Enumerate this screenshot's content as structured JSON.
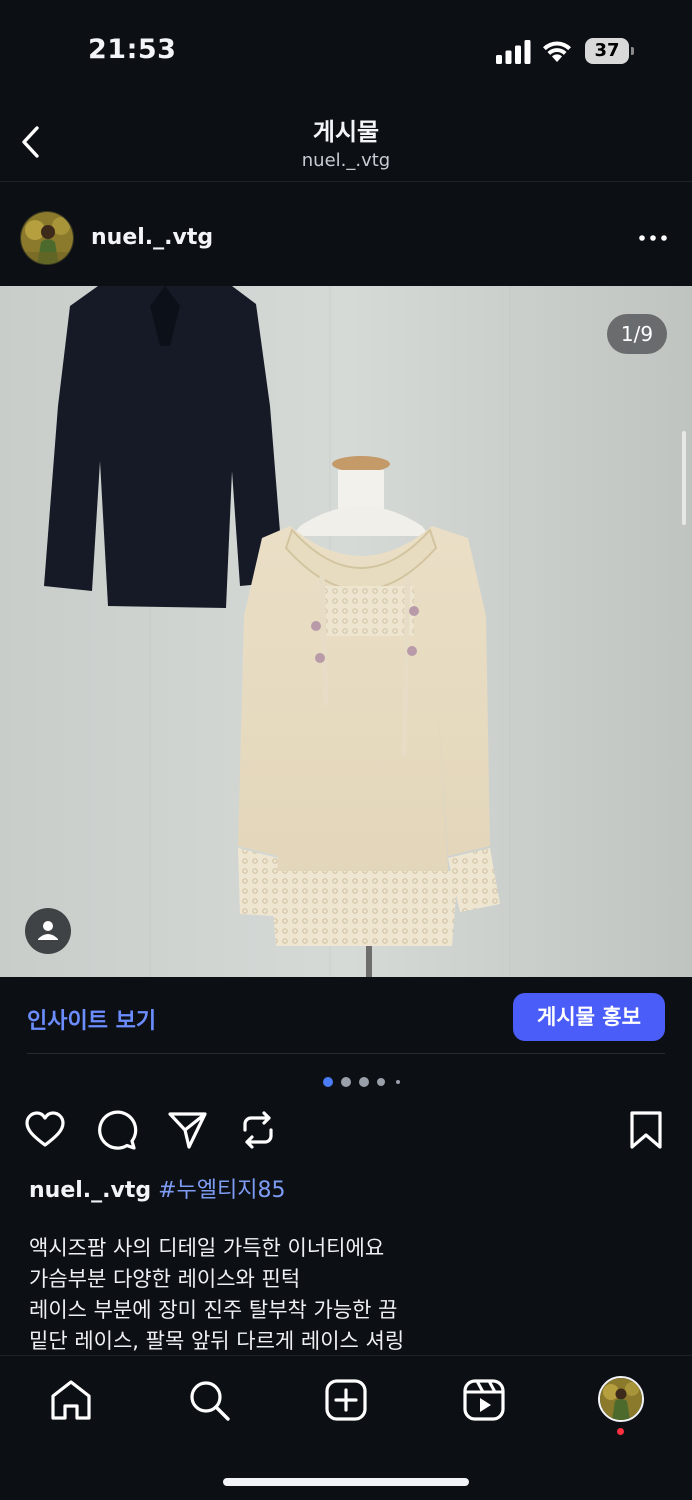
{
  "status_bar": {
    "time": "21:53",
    "battery_level": "37"
  },
  "header": {
    "title": "게시물",
    "subtitle": "nuel._.vtg"
  },
  "post": {
    "username": "nuel._.vtg",
    "image_counter": "1/9",
    "insights_label": "인사이트 보기",
    "promote_label": "게시물 홍보",
    "carousel": {
      "total_indicator_dots": 5,
      "active_index": 0
    },
    "caption": {
      "author": "nuel._.vtg",
      "hashtag": "#누엘티지85",
      "lines": [
        "액시즈팜 사의 디테일 가득한 이너티에요",
        "가슴부분 다양한 레이스와 핀턱",
        "레이스 부분에 장미 진주 탈부착 가능한 끔",
        "밑단 레이스, 팔목 앞뒤 다르게 레이스 셔링"
      ]
    }
  },
  "actions": [
    "heart-icon",
    "comment-icon",
    "share-icon",
    "repost-icon",
    "bookmark-icon"
  ],
  "tab_bar": [
    "home-icon",
    "search-icon",
    "create-icon",
    "reels-icon",
    "profile-avatar"
  ],
  "colors": {
    "background": "#0c0f14",
    "accent": "#4a5df9",
    "link": "#6b8dff",
    "hashtag": "#7f9cf5",
    "notification": "#ff3040"
  }
}
